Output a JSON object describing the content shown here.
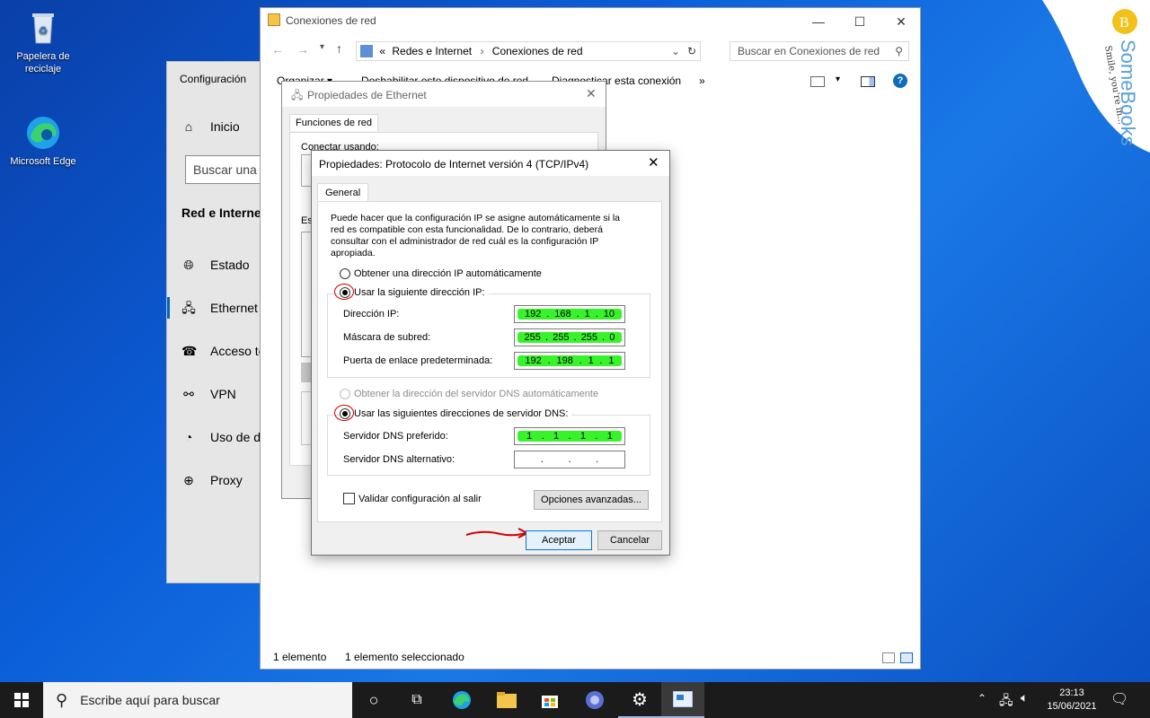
{
  "desktop": {
    "icons": [
      {
        "label": "Papelera de\nreciclaje",
        "icon": "recycle-bin-icon"
      },
      {
        "label": "Microsoft Edge",
        "icon": "edge-icon"
      }
    ]
  },
  "brand": {
    "text": "SomeBooks",
    "tagline": "Smile, you're in..."
  },
  "settings": {
    "title": "Configuración",
    "home": "Inicio",
    "search_placeholder": "Buscar una c",
    "section": "Red e Internet",
    "nav": [
      {
        "label": "Estado",
        "icon": "globe-icon"
      },
      {
        "label": "Ethernet",
        "icon": "ethernet-icon"
      },
      {
        "label": "Acceso te",
        "icon": "dialup-icon"
      },
      {
        "label": "VPN",
        "icon": "vpn-icon"
      },
      {
        "label": "Uso de da",
        "icon": "data-usage-icon"
      },
      {
        "label": "Proxy",
        "icon": "proxy-icon"
      }
    ]
  },
  "explorer": {
    "title": "Conexiones de red",
    "breadcrumb_prefix": "«",
    "breadcrumb": [
      "Redes e Internet",
      "Conexiones de red"
    ],
    "search_placeholder": "Buscar en Conexiones de red",
    "commands": [
      "Organizar ▾",
      "Deshabilitar este dispositivo de red",
      "Diagnosticar esta conexión",
      "»"
    ],
    "status_count": "1 elemento",
    "status_selected": "1 elemento seleccionado"
  },
  "eth_dialog": {
    "title": "Propiedades de Ethernet",
    "tab": "Funciones de red",
    "conn_label": "Conectar usando:",
    "items_label": "Es"
  },
  "tcpip": {
    "title": "Propiedades: Protocolo de Internet versión 4 (TCP/IPv4)",
    "tab": "General",
    "description": "Puede hacer que la configuración IP se asigne automáticamente si la red es compatible con esta funcionalidad. De lo contrario, deberá consultar con el administrador de red cuál es la configuración IP apropiada.",
    "auto_ip": "Obtener una dirección IP automáticamente",
    "manual_ip": "Usar la siguiente dirección IP:",
    "ip_label": "Dirección IP:",
    "ip": [
      "192",
      "168",
      "1",
      "10"
    ],
    "mask_label": "Máscara de subred:",
    "mask": [
      "255",
      "255",
      "255",
      "0"
    ],
    "gw_label": "Puerta de enlace predeterminada:",
    "gw": [
      "192",
      "198",
      "1",
      "1"
    ],
    "auto_dns": "Obtener la dirección del servidor DNS automáticamente",
    "manual_dns": "Usar las siguientes direcciones de servidor DNS:",
    "dns1_label": "Servidor DNS preferido:",
    "dns1": [
      "1",
      "1",
      "1",
      "1"
    ],
    "dns2_label": "Servidor DNS alternativo:",
    "dns2": [
      "",
      "",
      "",
      ""
    ],
    "validate": "Validar configuración al salir",
    "advanced": "Opciones avanzadas...",
    "ok": "Aceptar",
    "cancel": "Cancelar"
  },
  "taskbar": {
    "search_placeholder": "Escribe aquí para buscar",
    "time": "23:13",
    "date": "15/06/2021"
  }
}
